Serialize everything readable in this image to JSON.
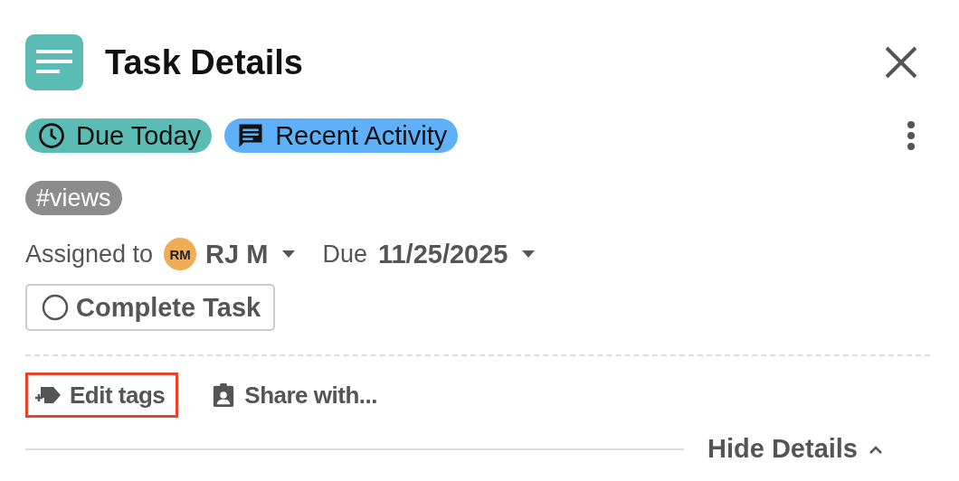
{
  "header": {
    "title": "Task Details"
  },
  "chips": [
    {
      "kind": "due",
      "label": "Due Today",
      "color": "#5bbcb6"
    },
    {
      "kind": "activity",
      "label": "Recent Activity",
      "color": "#5eb0f8"
    }
  ],
  "tags": [
    {
      "label": "#views"
    }
  ],
  "assignment": {
    "label": "Assigned to",
    "avatar": "RM",
    "assignee": "RJ M",
    "due_label": "Due",
    "due_date": "11/25/2025"
  },
  "complete_button": {
    "label": "Complete Task",
    "checked": false
  },
  "actions": [
    {
      "kind": "tag",
      "label": "Edit tags",
      "highlighted": true
    },
    {
      "kind": "share",
      "label": "Share with...",
      "highlighted": false
    }
  ],
  "footer": {
    "toggle": "Hide Details",
    "expanded": true
  }
}
